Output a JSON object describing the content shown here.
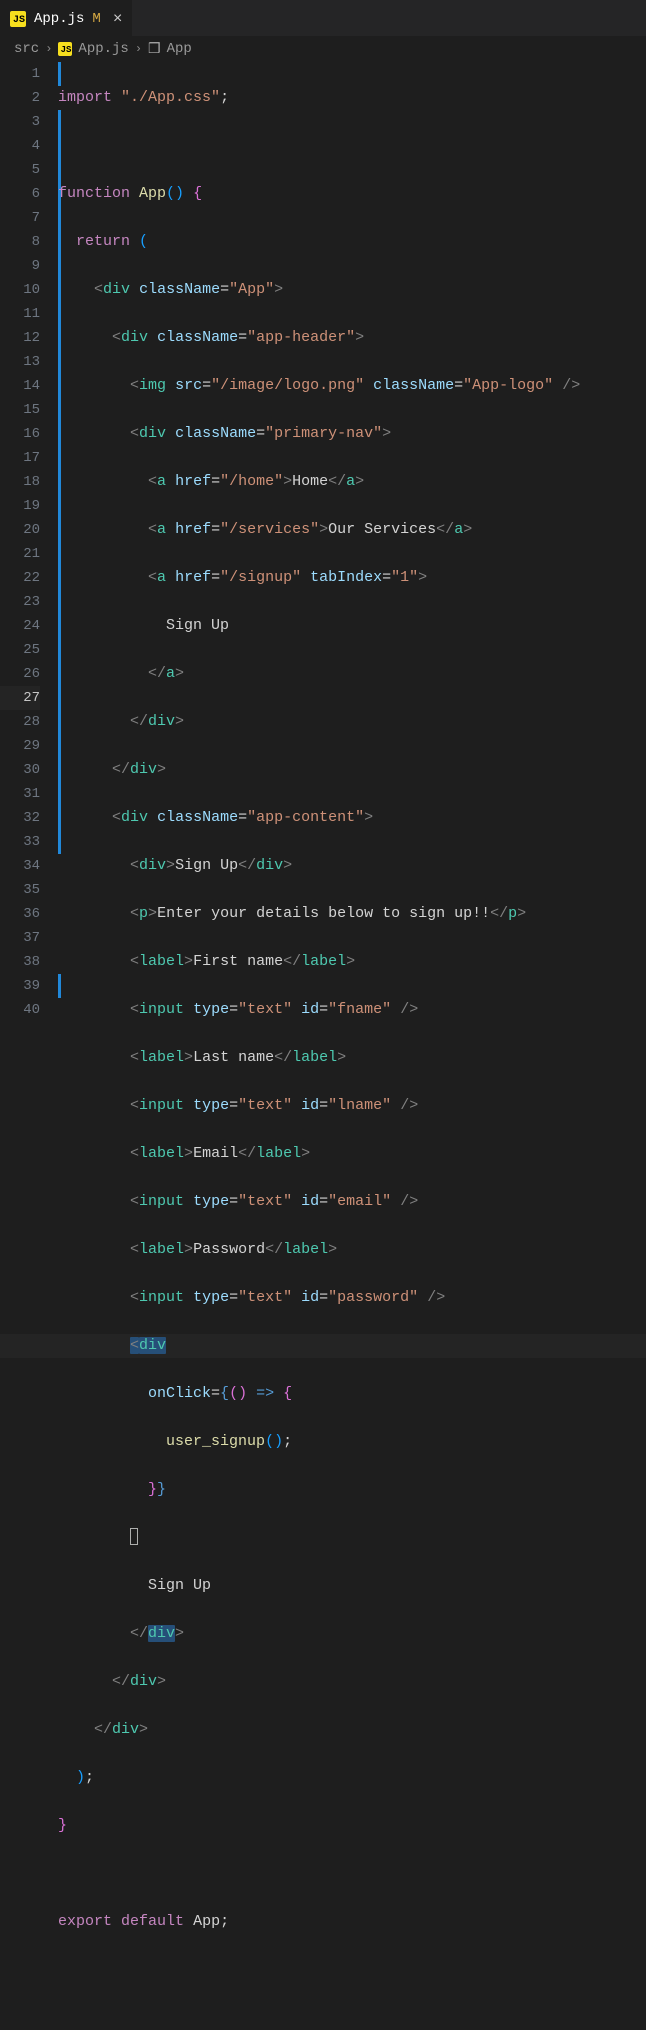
{
  "tab": {
    "filename": "App.js",
    "modified_indicator": "M",
    "close_glyph": "×",
    "js_badge": "JS"
  },
  "breadcrumbs": {
    "seg1": "src",
    "seg2": "App.js",
    "seg3": "App",
    "js_badge": "JS"
  },
  "lines": {
    "count": 40,
    "current": 27
  },
  "code": {
    "l1_kw": "import",
    "l1_str": "\"./App.css\"",
    "l3_kw": "function",
    "l3_fn": "App",
    "l4_kw": "return",
    "l5_cls": "className",
    "l5_app": "\"App\"",
    "l6_hdr": "\"app-header\"",
    "l7_img": "img",
    "l7_src": "src",
    "l7_srcv": "\"/image/logo.png\"",
    "l7_logo": "\"App-logo\"",
    "l8_nav": "\"primary-nav\"",
    "l9_href": "href",
    "l9_home": "\"/home\"",
    "l9_home_txt": "Home",
    "l10_srv": "\"/services\"",
    "l10_srv_txt": "Our Services",
    "l11_signup": "\"/signup\"",
    "l11_tab": "tabIndex",
    "l11_tabv": "\"1\"",
    "l12_txt": "Sign Up",
    "l16_content": "\"app-content\"",
    "l17_signup": "Sign Up",
    "l18_p": "Enter your details below to sign up!!",
    "l19_fname": "First name",
    "l20_type": "type",
    "l20_text": "\"text\"",
    "l20_id": "id",
    "l20_fname": "\"fname\"",
    "l21_lname": "Last name",
    "l22_lname": "\"lname\"",
    "l23_email": "Email",
    "l24_email": "\"email\"",
    "l25_pwd": "Password",
    "l26_pwd": "\"password\"",
    "l28_onclick": "onClick",
    "l29_call": "user_signup",
    "l32_txt": "Sign Up",
    "l39_export": "export",
    "l39_default": "default",
    "l39_app": "App",
    "tag_div": "div",
    "tag_a": "a",
    "tag_p": "p",
    "tag_label": "label",
    "tag_input": "input"
  }
}
